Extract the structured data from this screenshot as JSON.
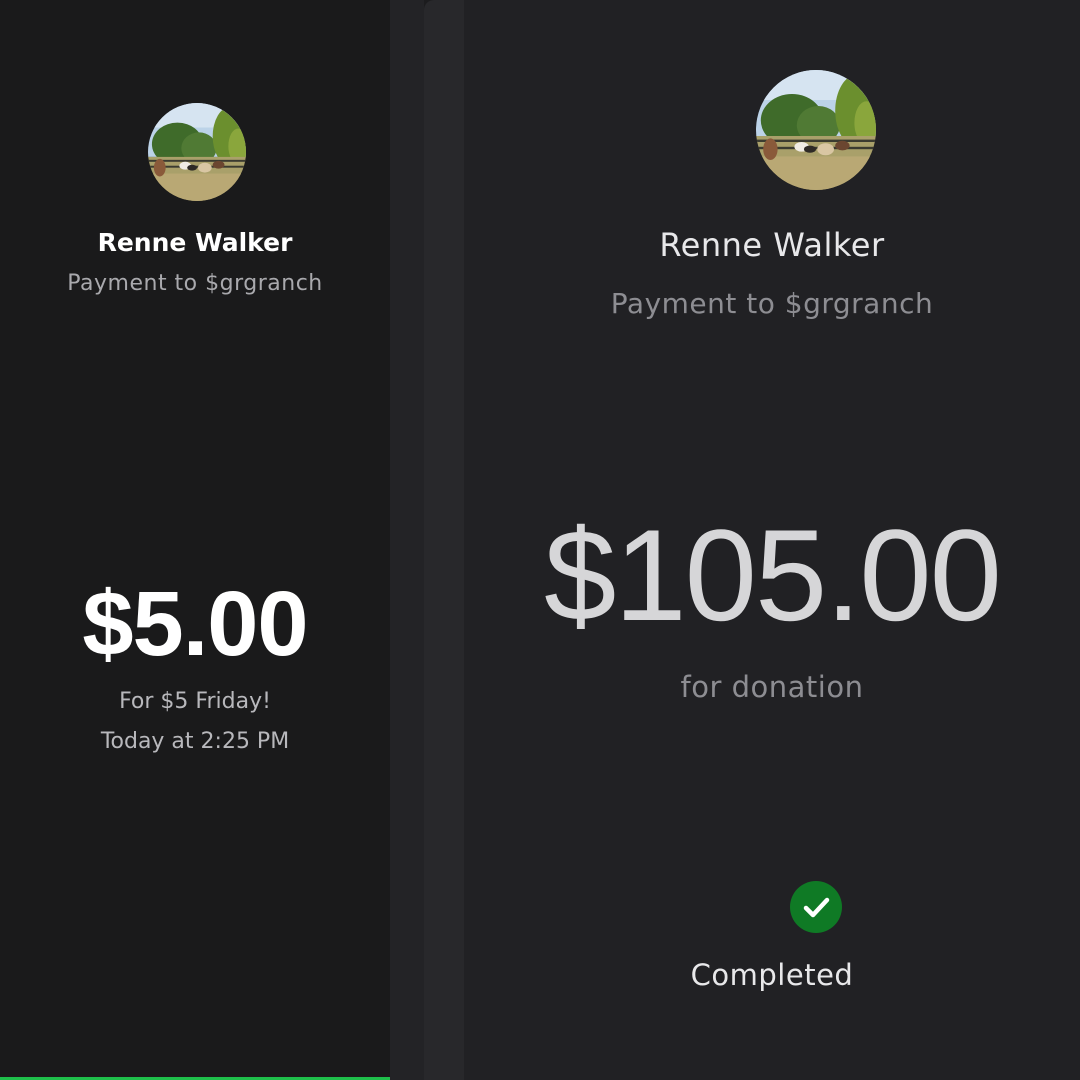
{
  "left": {
    "name": "Renne Walker",
    "subtitle": "Payment to $grgranch",
    "amount": "$5.00",
    "note": "For $5 Friday!",
    "time": "Today at 2:25 PM",
    "avatar_icon": "ranch-photo-icon",
    "accent_color": "#1fbf4b"
  },
  "right": {
    "name": "Renne Walker",
    "subtitle": "Payment to $grgranch",
    "amount": "$105.00",
    "note": "for donation",
    "status": "Completed",
    "status_icon": "checkmark-circle-icon",
    "status_color": "#0f7a25",
    "avatar_icon": "ranch-photo-icon"
  }
}
